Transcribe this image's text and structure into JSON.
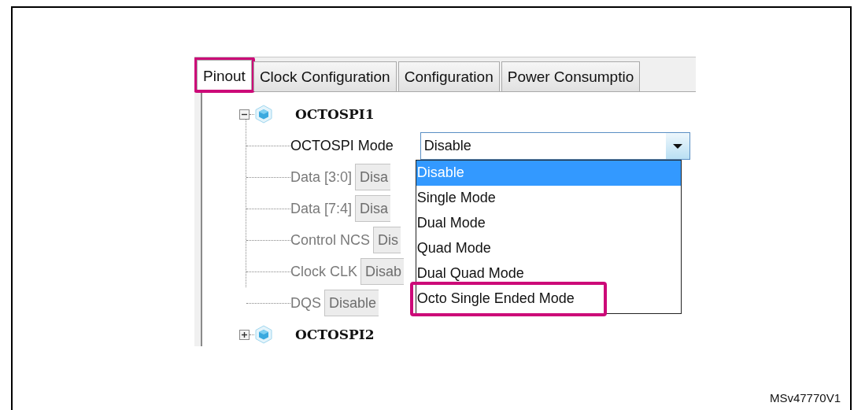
{
  "tabs": [
    {
      "label": "Pinout",
      "selected": true,
      "callout": true
    },
    {
      "label": "Clock Configuration",
      "selected": false,
      "callout": false
    },
    {
      "label": "Configuration",
      "selected": false,
      "callout": false
    },
    {
      "label": "Power Consumptio",
      "selected": false,
      "callout": false
    }
  ],
  "tree": [
    {
      "label": "OCTOSPI1",
      "expanded": true,
      "children": [
        {
          "label": "OCTOSPI Mode",
          "kind": "dropdown",
          "value": "Disable",
          "disabled": false,
          "open": true,
          "options": [
            {
              "label": "Disable",
              "selected": true,
              "callout": false
            },
            {
              "label": "Single Mode",
              "selected": false,
              "callout": false
            },
            {
              "label": "Dual Mode",
              "selected": false,
              "callout": false
            },
            {
              "label": "Quad Mode",
              "selected": false,
              "callout": false
            },
            {
              "label": "Dual Quad Mode",
              "selected": false,
              "callout": false
            },
            {
              "label": "Octo Single Ended Mode",
              "selected": false,
              "callout": true
            }
          ]
        },
        {
          "label": "Data [3:0]",
          "kind": "dropdown",
          "value": "Disa",
          "disabled": true
        },
        {
          "label": "Data [7:4]",
          "kind": "dropdown",
          "value": "Disa",
          "disabled": true
        },
        {
          "label": "Control NCS",
          "kind": "dropdown",
          "value": "Dis",
          "disabled": true
        },
        {
          "label": "Clock CLK",
          "kind": "dropdown",
          "value": "Disab",
          "disabled": true
        },
        {
          "label": "DQS",
          "kind": "dropdown",
          "value": "Disable",
          "disabled": true
        }
      ]
    },
    {
      "label": "OCTOSPI2",
      "expanded": false
    }
  ],
  "figure": {
    "caption": "MSv47770V1"
  }
}
